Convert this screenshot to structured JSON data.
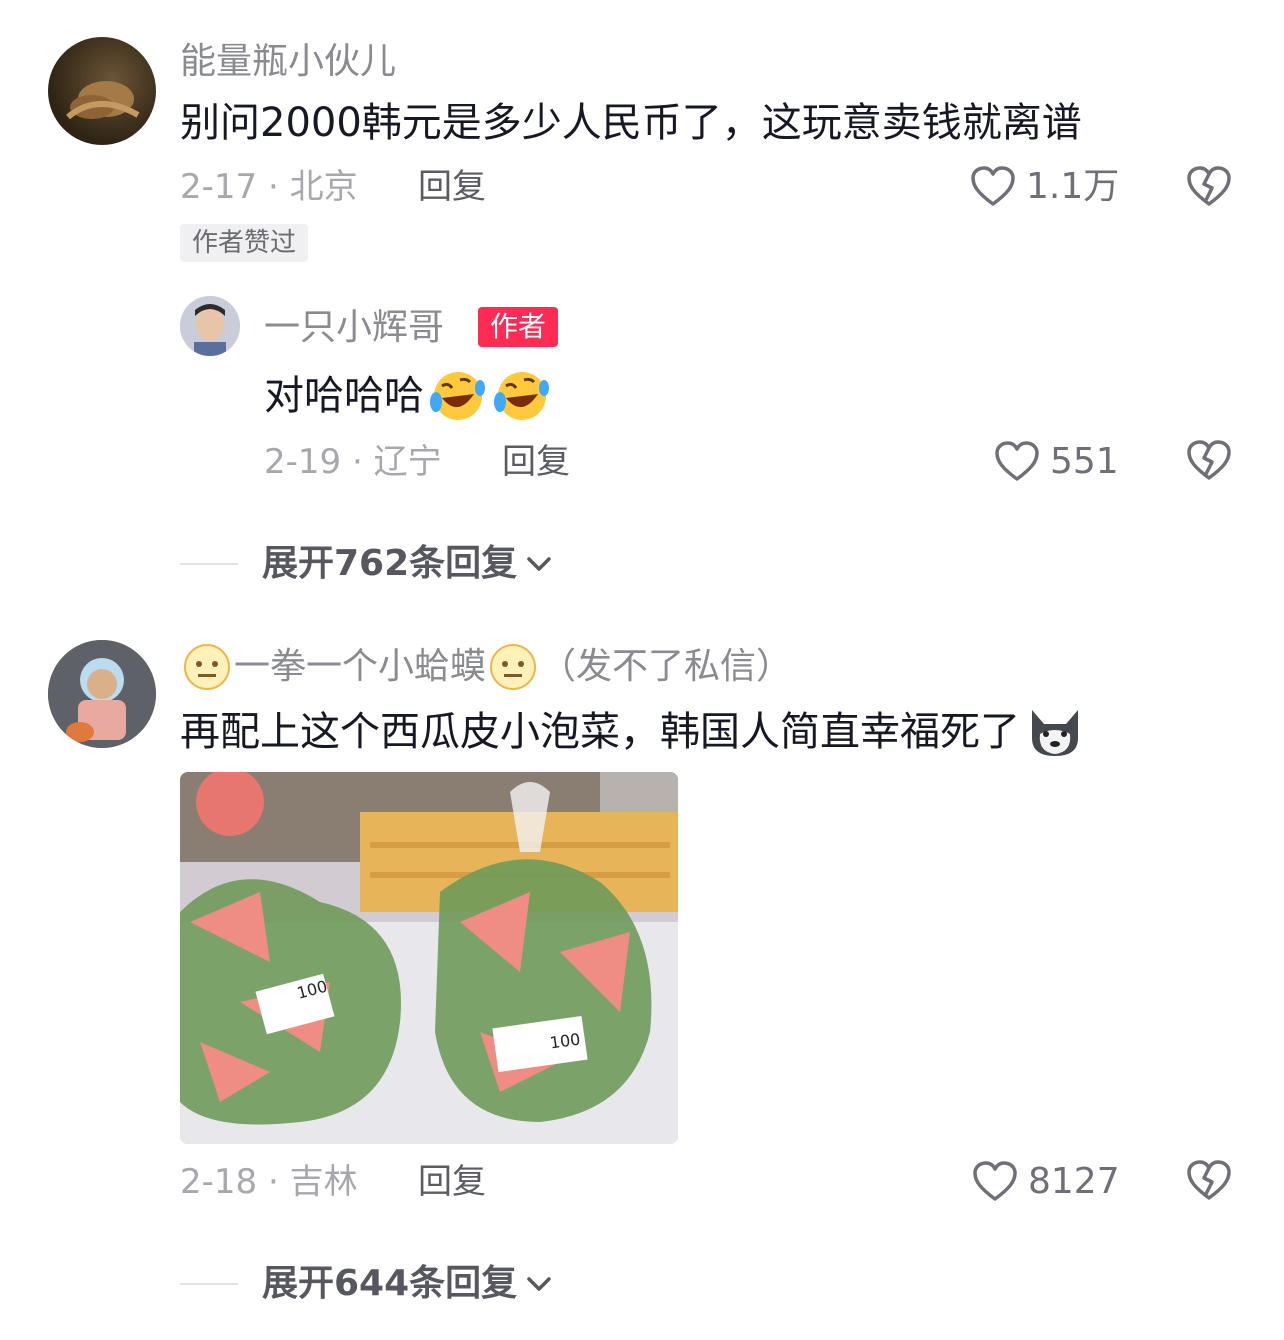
{
  "comments": [
    {
      "username": "能量瓶小伙儿",
      "text": "别问2000韩元是多少人民币了，这玩意卖钱就离谱",
      "date_location": "2-17 · 北京",
      "reply_label": "回复",
      "likes": "1.1万",
      "badge": "作者赞过",
      "replies": [
        {
          "username": "一只小辉哥",
          "author_badge": "作者",
          "text": "对哈哈哈",
          "date_location": "2-19 · 辽宁",
          "reply_label": "回复",
          "likes": "551"
        }
      ],
      "expand_label": "展开762条回复"
    },
    {
      "username_prefix": "一拳一个小蛤蟆",
      "username_suffix": "（发不了私信）",
      "text": "再配上这个西瓜皮小泡菜，韩国人简直幸福死了",
      "date_location": "2-18 · 吉林",
      "reply_label": "回复",
      "likes": "8127",
      "image_price_tag": "100",
      "expand_label": "展开644条回复"
    }
  ],
  "colors": {
    "author_badge": "#fe2c55",
    "text": "#161823",
    "meta": "#a7a8ad"
  },
  "icons": [
    "heart-icon",
    "dislike-broken-heart-icon",
    "chevron-down-icon",
    "laugh-cry-emoji",
    "neutral-face-emoji",
    "husky-emoji"
  ]
}
